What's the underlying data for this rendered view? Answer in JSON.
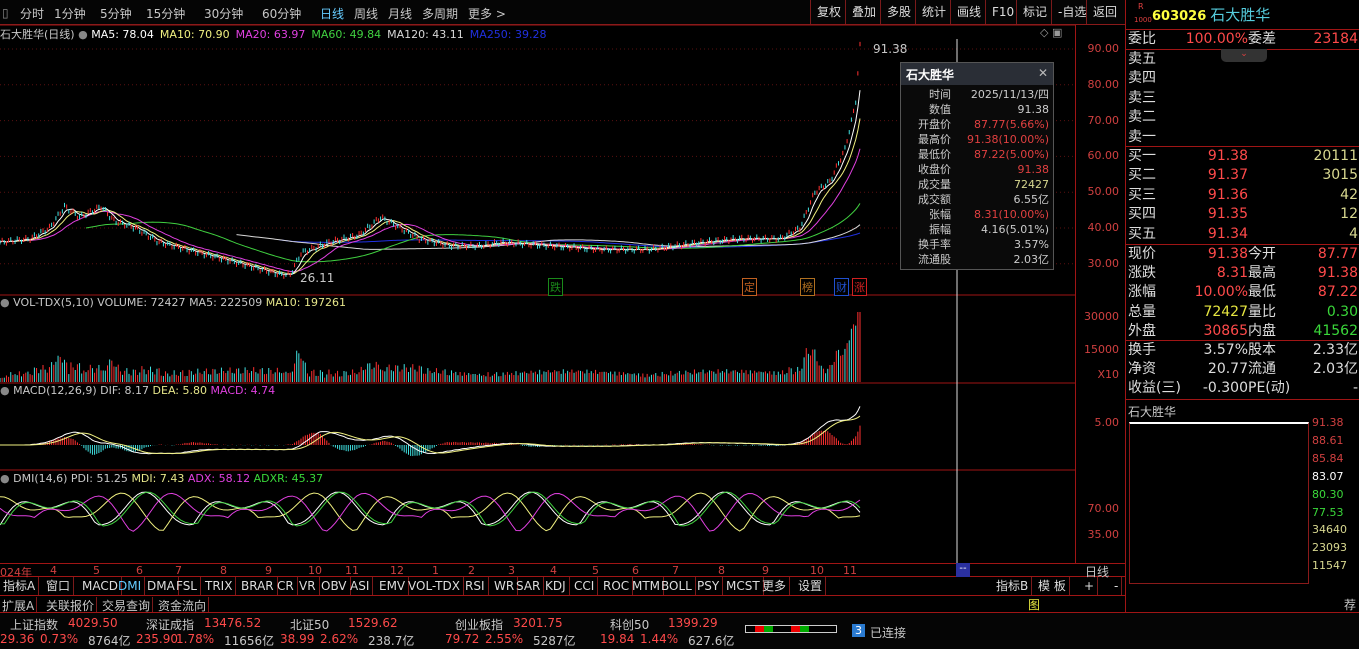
{
  "toolbar": {
    "periods": [
      "分时",
      "1分钟",
      "5分钟",
      "15分钟",
      "30分钟",
      "60分钟",
      "日线",
      "周线",
      "月线",
      "多周期",
      "更多 >"
    ],
    "active": "日线",
    "buttons": [
      "复权",
      "叠加",
      "多股",
      "统计",
      "画线",
      "F10",
      "标记",
      "-自选",
      "返回"
    ]
  },
  "main": {
    "title": "石大胜华(日线)",
    "ma": [
      {
        "label": "MA5: 78.04",
        "color": "#ffffff"
      },
      {
        "label": "MA10: 70.90",
        "color": "#f0f080"
      },
      {
        "label": "MA20: 63.97",
        "color": "#e040e0"
      },
      {
        "label": "MA60: 49.84",
        "color": "#40d040"
      },
      {
        "label": "MA120: 43.11",
        "color": "#d8d8d8"
      },
      {
        "label": "MA250: 39.28",
        "color": "#2030e0"
      }
    ],
    "price_ticks": [
      "90.00",
      "80.00",
      "70.00",
      "60.00",
      "50.00",
      "40.00",
      "30.00"
    ],
    "high_label": "91.38",
    "low_label": "26.11",
    "markers": [
      {
        "text": "跌",
        "color": "#1a8a1a"
      },
      {
        "text": "定",
        "color": "#c06020"
      },
      {
        "text": "榜",
        "color": "#b07020"
      },
      {
        "text": "财",
        "color": "#2050d0"
      },
      {
        "text": "涨",
        "color": "#d02020"
      }
    ]
  },
  "chart_data": {
    "type": "line",
    "title": "石大胜华 日线",
    "close_series": [
      [
        0,
        36
      ],
      [
        14,
        37
      ],
      [
        23,
        40
      ],
      [
        30,
        46
      ],
      [
        37,
        43
      ],
      [
        47,
        46
      ],
      [
        53,
        42
      ],
      [
        63,
        40
      ],
      [
        74,
        36
      ],
      [
        93,
        33
      ],
      [
        112,
        30
      ],
      [
        130,
        27
      ],
      [
        135,
        27
      ],
      [
        140,
        33
      ],
      [
        153,
        36
      ],
      [
        167,
        38
      ],
      [
        177,
        43
      ],
      [
        186,
        40
      ],
      [
        195,
        37
      ],
      [
        209,
        35
      ],
      [
        223,
        35
      ],
      [
        233,
        36
      ],
      [
        256,
        35
      ],
      [
        279,
        34
      ],
      [
        302,
        34
      ],
      [
        326,
        36
      ],
      [
        344,
        37
      ],
      [
        363,
        37
      ],
      [
        372,
        40
      ],
      [
        379,
        50
      ],
      [
        386,
        53
      ],
      [
        393,
        62
      ],
      [
        398,
        75
      ],
      [
        400,
        91.38
      ]
    ],
    "ylim": [
      25,
      95
    ]
  },
  "tooltip": {
    "title": "石大胜华",
    "rows": [
      [
        "时间",
        "2025/11/13/四",
        "#cccccc"
      ],
      [
        "数值",
        "91.38",
        "#cccccc"
      ],
      [
        "开盘价",
        "87.77(5.66%)",
        "#e04040"
      ],
      [
        "最高价",
        "91.38(10.00%)",
        "#e04040"
      ],
      [
        "最低价",
        "87.22(5.00%)",
        "#e04040"
      ],
      [
        "收盘价",
        "91.38",
        "#e04040"
      ],
      [
        "成交量",
        "72427",
        "#d8d890"
      ],
      [
        "成交额",
        "6.55亿",
        "#cccccc"
      ],
      [
        "张幅",
        "8.31(10.00%)",
        "#e04040"
      ],
      [
        "振幅",
        "4.16(5.01%)",
        "#cccccc"
      ],
      [
        "换手率",
        "3.57%",
        "#cccccc"
      ],
      [
        "流通股",
        "2.03亿",
        "#cccccc"
      ]
    ]
  },
  "vol": {
    "name": "VOL-TDX(5,10)",
    "volume": "VOLUME: 72427",
    "ma5": "MA5: 222509",
    "ma10": "MA10: 197261",
    "ticks": [
      "30000",
      "15000",
      "X10"
    ]
  },
  "macd": {
    "name": "MACD(12,26,9)",
    "dif": "DIF: 8.17",
    "dea": "DEA: 5.80",
    "macd": "MACD: 4.74",
    "ticks": [
      "5.00"
    ]
  },
  "dmi": {
    "name": "DMI(14,6)",
    "pdi": "PDI: 51.25",
    "mdi": "MDI: 7.43",
    "adx": "ADX: 58.12",
    "adxr": "ADXR: 45.37",
    "ticks": [
      "70.00",
      "35.00"
    ]
  },
  "dates": [
    "024年",
    "4",
    "5",
    "6",
    "7",
    "8",
    "9",
    "10",
    "11",
    "12",
    "1",
    "2",
    "3",
    "4",
    "5",
    "6",
    "7",
    "8",
    "9",
    "10",
    "11"
  ],
  "cursor_label": "--",
  "period_label": "日线",
  "indicators": [
    "指标A",
    "窗口",
    "MACD",
    "DMI",
    "DMA",
    "FSL",
    "TRIX",
    "BRAR",
    "CR",
    "VR",
    "OBV",
    "ASI",
    "EMV",
    "VOL-TDX",
    "RSI",
    "WR",
    "SAR",
    "KDJ",
    "CCI",
    "ROC",
    "MTM",
    "BOLL",
    "PSY",
    "MCST",
    "更多",
    "设置"
  ],
  "indicators_right": [
    "指标B",
    "模 板",
    "+",
    "-"
  ],
  "ext": [
    "扩展A",
    "关联报价",
    "交易查询",
    "资金流向"
  ],
  "right": {
    "code": "603026",
    "name": "石大胜华",
    "badge_r": "R",
    "badge_n": "1000",
    "weibi": [
      "委比",
      "100.00%",
      "委差",
      "23184"
    ],
    "sell": [
      "卖五",
      "卖四",
      "卖三",
      "卖二",
      "卖一"
    ],
    "buy": [
      [
        "买一",
        "91.38",
        "20111"
      ],
      [
        "买二",
        "91.37",
        "3015"
      ],
      [
        "买三",
        "91.36",
        "42"
      ],
      [
        "买四",
        "91.35",
        "12"
      ],
      [
        "买五",
        "91.34",
        "4"
      ]
    ],
    "quote": [
      [
        "现价",
        "91.38",
        "今开",
        "87.77"
      ],
      [
        "涨跌",
        "8.31",
        "最高",
        "91.38"
      ],
      [
        "涨幅",
        "10.00%",
        "最低",
        "87.22"
      ],
      [
        "总量",
        "72427",
        "量比",
        "0.30"
      ],
      [
        "外盘",
        "30865",
        "内盘",
        "41562"
      ]
    ],
    "info": [
      [
        "换手",
        "3.57%",
        "股本",
        "2.33亿"
      ],
      [
        "净资",
        "20.77",
        "流通",
        "2.03亿"
      ],
      [
        "收益(三)",
        "-0.300",
        "PE(动)",
        "-"
      ]
    ],
    "mini_title": "石大胜华",
    "mini_ticks": [
      "91.38",
      "88.61",
      "85.84",
      "83.07",
      "80.30",
      "77.53",
      "34640",
      "23093",
      "11547"
    ],
    "tu": "图",
    "tui": "荐"
  },
  "status": {
    "indices": [
      {
        "name": "上证指数",
        "val": "4029.50",
        "chg": "29.36",
        "pct": "0.73%",
        "amt": "8764亿"
      },
      {
        "name": "深证成指",
        "val": "13476.52",
        "chg": "235.90",
        "pct": "1.78%",
        "amt": "11656亿"
      },
      {
        "name": "北证50",
        "val": "1529.62",
        "chg": "38.99",
        "pct": "2.62%",
        "amt": "238.7亿"
      },
      {
        "name": "创业板指",
        "val": "3201.75",
        "chg": "79.72",
        "pct": "2.55%",
        "amt": "5287亿"
      },
      {
        "name": "科创50",
        "val": "1399.29",
        "chg": "19.84",
        "pct": "1.44%",
        "amt": "627.6亿"
      }
    ],
    "conn_num": "3",
    "conn": "已连接"
  }
}
